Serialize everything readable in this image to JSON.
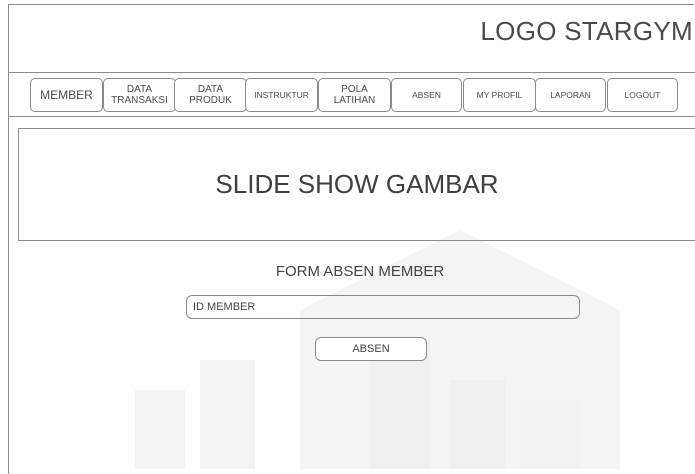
{
  "header": {
    "logo_text": "LOGO STARGYM"
  },
  "nav": {
    "items": [
      {
        "label": "MEMBER"
      },
      {
        "label": "DATA\nTRANSAKSI"
      },
      {
        "label": "DATA\nPRODUK"
      },
      {
        "label": "INSTRUKTUR"
      },
      {
        "label": "POLA\nLATIHAN"
      },
      {
        "label": "ABSEN"
      },
      {
        "label": "MY PROFIL"
      },
      {
        "label": "LAPORAN"
      },
      {
        "label": "LOGOUT"
      }
    ]
  },
  "slideshow": {
    "text": "SLIDE SHOW GAMBAR"
  },
  "form": {
    "title": "FORM ABSEN MEMBER",
    "id_placeholder": "ID MEMBER",
    "submit_label": "ABSEN"
  },
  "colors": {
    "border": "#8c8c8c",
    "text": "#444444",
    "watermark": "#f2f2f2"
  }
}
